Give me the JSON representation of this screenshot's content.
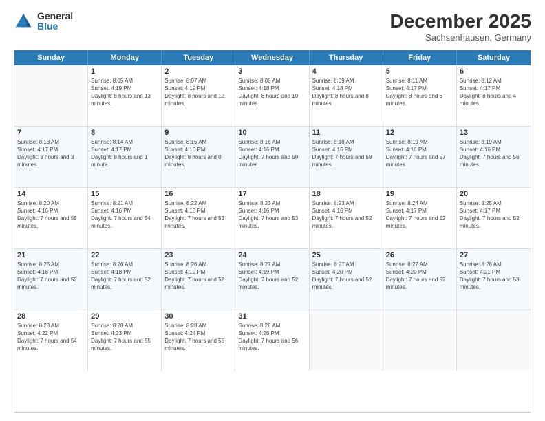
{
  "logo": {
    "general": "General",
    "blue": "Blue"
  },
  "title": "December 2025",
  "location": "Sachsenhausen, Germany",
  "weekdays": [
    "Sunday",
    "Monday",
    "Tuesday",
    "Wednesday",
    "Thursday",
    "Friday",
    "Saturday"
  ],
  "weeks": [
    [
      {
        "num": "",
        "empty": true
      },
      {
        "num": "1",
        "sunrise": "8:05 AM",
        "sunset": "4:19 PM",
        "daylight": "8 hours and 13 minutes."
      },
      {
        "num": "2",
        "sunrise": "8:07 AM",
        "sunset": "4:19 PM",
        "daylight": "8 hours and 12 minutes."
      },
      {
        "num": "3",
        "sunrise": "8:08 AM",
        "sunset": "4:18 PM",
        "daylight": "8 hours and 10 minutes."
      },
      {
        "num": "4",
        "sunrise": "8:09 AM",
        "sunset": "4:18 PM",
        "daylight": "8 hours and 8 minutes."
      },
      {
        "num": "5",
        "sunrise": "8:11 AM",
        "sunset": "4:17 PM",
        "daylight": "8 hours and 6 minutes."
      },
      {
        "num": "6",
        "sunrise": "8:12 AM",
        "sunset": "4:17 PM",
        "daylight": "8 hours and 4 minutes."
      }
    ],
    [
      {
        "num": "7",
        "sunrise": "8:13 AM",
        "sunset": "4:17 PM",
        "daylight": "8 hours and 3 minutes."
      },
      {
        "num": "8",
        "sunrise": "8:14 AM",
        "sunset": "4:17 PM",
        "daylight": "8 hours and 1 minute."
      },
      {
        "num": "9",
        "sunrise": "8:15 AM",
        "sunset": "4:16 PM",
        "daylight": "8 hours and 0 minutes."
      },
      {
        "num": "10",
        "sunrise": "8:16 AM",
        "sunset": "4:16 PM",
        "daylight": "7 hours and 59 minutes."
      },
      {
        "num": "11",
        "sunrise": "8:18 AM",
        "sunset": "4:16 PM",
        "daylight": "7 hours and 58 minutes."
      },
      {
        "num": "12",
        "sunrise": "8:19 AM",
        "sunset": "4:16 PM",
        "daylight": "7 hours and 57 minutes."
      },
      {
        "num": "13",
        "sunrise": "8:19 AM",
        "sunset": "4:16 PM",
        "daylight": "7 hours and 56 minutes."
      }
    ],
    [
      {
        "num": "14",
        "sunrise": "8:20 AM",
        "sunset": "4:16 PM",
        "daylight": "7 hours and 55 minutes."
      },
      {
        "num": "15",
        "sunrise": "8:21 AM",
        "sunset": "4:16 PM",
        "daylight": "7 hours and 54 minutes."
      },
      {
        "num": "16",
        "sunrise": "8:22 AM",
        "sunset": "4:16 PM",
        "daylight": "7 hours and 53 minutes."
      },
      {
        "num": "17",
        "sunrise": "8:23 AM",
        "sunset": "4:16 PM",
        "daylight": "7 hours and 53 minutes."
      },
      {
        "num": "18",
        "sunrise": "8:23 AM",
        "sunset": "4:16 PM",
        "daylight": "7 hours and 52 minutes."
      },
      {
        "num": "19",
        "sunrise": "8:24 AM",
        "sunset": "4:17 PM",
        "daylight": "7 hours and 52 minutes."
      },
      {
        "num": "20",
        "sunrise": "8:25 AM",
        "sunset": "4:17 PM",
        "daylight": "7 hours and 52 minutes."
      }
    ],
    [
      {
        "num": "21",
        "sunrise": "8:25 AM",
        "sunset": "4:18 PM",
        "daylight": "7 hours and 52 minutes."
      },
      {
        "num": "22",
        "sunrise": "8:26 AM",
        "sunset": "4:18 PM",
        "daylight": "7 hours and 52 minutes."
      },
      {
        "num": "23",
        "sunrise": "8:26 AM",
        "sunset": "4:19 PM",
        "daylight": "7 hours and 52 minutes."
      },
      {
        "num": "24",
        "sunrise": "8:27 AM",
        "sunset": "4:19 PM",
        "daylight": "7 hours and 52 minutes."
      },
      {
        "num": "25",
        "sunrise": "8:27 AM",
        "sunset": "4:20 PM",
        "daylight": "7 hours and 52 minutes."
      },
      {
        "num": "26",
        "sunrise": "8:27 AM",
        "sunset": "4:20 PM",
        "daylight": "7 hours and 52 minutes."
      },
      {
        "num": "27",
        "sunrise": "8:28 AM",
        "sunset": "4:21 PM",
        "daylight": "7 hours and 53 minutes."
      }
    ],
    [
      {
        "num": "28",
        "sunrise": "8:28 AM",
        "sunset": "4:22 PM",
        "daylight": "7 hours and 54 minutes."
      },
      {
        "num": "29",
        "sunrise": "8:28 AM",
        "sunset": "4:23 PM",
        "daylight": "7 hours and 55 minutes."
      },
      {
        "num": "30",
        "sunrise": "8:28 AM",
        "sunset": "4:24 PM",
        "daylight": "7 hours and 55 minutes."
      },
      {
        "num": "31",
        "sunrise": "8:28 AM",
        "sunset": "4:25 PM",
        "daylight": "7 hours and 56 minutes."
      },
      {
        "num": "",
        "empty": true
      },
      {
        "num": "",
        "empty": true
      },
      {
        "num": "",
        "empty": true
      }
    ]
  ]
}
